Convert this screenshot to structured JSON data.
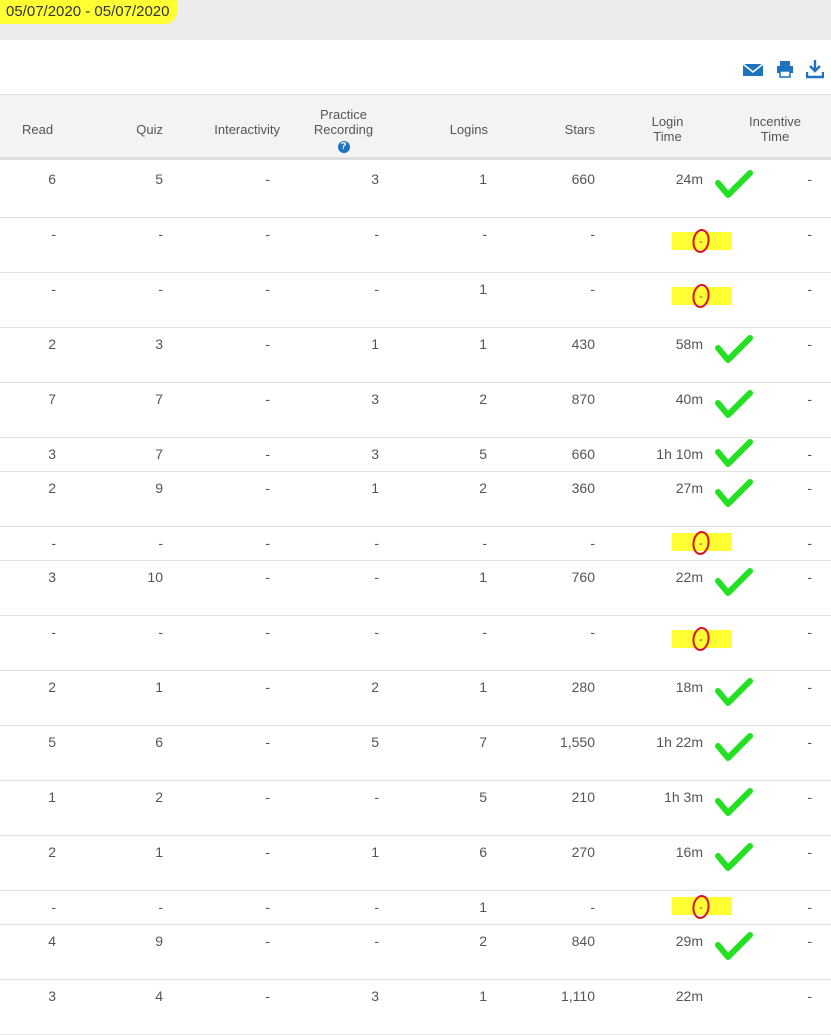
{
  "date_range": "05/07/2020 - 05/07/2020",
  "toolbar": {
    "icons": [
      "mail-icon",
      "print-icon",
      "download-icon"
    ]
  },
  "colors": {
    "accent": "#1e73be",
    "highlight": "#ffff33",
    "check": "#22e022",
    "circle": "#e01010"
  },
  "columns": {
    "read": "Read",
    "quiz": "Quiz",
    "interactivity": "Interactivity",
    "practice_1": "Practice",
    "practice_2": "Recording",
    "logins": "Logins",
    "stars": "Stars",
    "login_time_1": "Login",
    "login_time_2": "Time",
    "incentive_1": "Incentive",
    "incentive_2": "Time"
  },
  "rows": [
    {
      "read": "6",
      "quiz": "5",
      "interactivity": "-",
      "practice": "3",
      "logins": "1",
      "stars": "660",
      "login_time": "24m",
      "incentive": "-",
      "mark": "check"
    },
    {
      "read": "-",
      "quiz": "-",
      "interactivity": "-",
      "practice": "-",
      "logins": "-",
      "stars": "-",
      "login_time": "",
      "incentive": "-",
      "mark": "circle"
    },
    {
      "read": "-",
      "quiz": "-",
      "interactivity": "-",
      "practice": "-",
      "logins": "1",
      "stars": "-",
      "login_time": "",
      "incentive": "-",
      "mark": "circle"
    },
    {
      "read": "2",
      "quiz": "3",
      "interactivity": "-",
      "practice": "1",
      "logins": "1",
      "stars": "430",
      "login_time": "58m",
      "incentive": "-",
      "mark": "check"
    },
    {
      "read": "7",
      "quiz": "7",
      "interactivity": "-",
      "practice": "3",
      "logins": "2",
      "stars": "870",
      "login_time": "40m",
      "incentive": "-",
      "mark": "check"
    },
    {
      "read": "3",
      "quiz": "7",
      "interactivity": "-",
      "practice": "3",
      "logins": "5",
      "stars": "660",
      "login_time": "1h 10m",
      "incentive": "-",
      "mark": "check"
    },
    {
      "read": "2",
      "quiz": "9",
      "interactivity": "-",
      "practice": "1",
      "logins": "2",
      "stars": "360",
      "login_time": "27m",
      "incentive": "-",
      "mark": "check"
    },
    {
      "read": "-",
      "quiz": "-",
      "interactivity": "-",
      "practice": "-",
      "logins": "-",
      "stars": "-",
      "login_time": "",
      "incentive": "-",
      "mark": "circle"
    },
    {
      "read": "3",
      "quiz": "10",
      "interactivity": "-",
      "practice": "-",
      "logins": "1",
      "stars": "760",
      "login_time": "22m",
      "incentive": "-",
      "mark": "check"
    },
    {
      "read": "-",
      "quiz": "-",
      "interactivity": "-",
      "practice": "-",
      "logins": "-",
      "stars": "-",
      "login_time": "",
      "incentive": "-",
      "mark": "circle"
    },
    {
      "read": "2",
      "quiz": "1",
      "interactivity": "-",
      "practice": "2",
      "logins": "1",
      "stars": "280",
      "login_time": "18m",
      "incentive": "-",
      "mark": "check"
    },
    {
      "read": "5",
      "quiz": "6",
      "interactivity": "-",
      "practice": "5",
      "logins": "7",
      "stars": "1,550",
      "login_time": "1h 22m",
      "incentive": "-",
      "mark": "check"
    },
    {
      "read": "1",
      "quiz": "2",
      "interactivity": "-",
      "practice": "-",
      "logins": "5",
      "stars": "210",
      "login_time": "1h 3m",
      "incentive": "-",
      "mark": "check"
    },
    {
      "read": "2",
      "quiz": "1",
      "interactivity": "-",
      "practice": "1",
      "logins": "6",
      "stars": "270",
      "login_time": "16m",
      "incentive": "-",
      "mark": "check"
    },
    {
      "read": "-",
      "quiz": "-",
      "interactivity": "-",
      "practice": "-",
      "logins": "1",
      "stars": "-",
      "login_time": "",
      "incentive": "-",
      "mark": "circle"
    },
    {
      "read": "4",
      "quiz": "9",
      "interactivity": "-",
      "practice": "-",
      "logins": "2",
      "stars": "840",
      "login_time": "29m",
      "incentive": "-",
      "mark": "check"
    },
    {
      "read": "3",
      "quiz": "4",
      "interactivity": "-",
      "practice": "3",
      "logins": "1",
      "stars": "1,110",
      "login_time": "22m",
      "incentive": "-",
      "mark": "none"
    }
  ]
}
